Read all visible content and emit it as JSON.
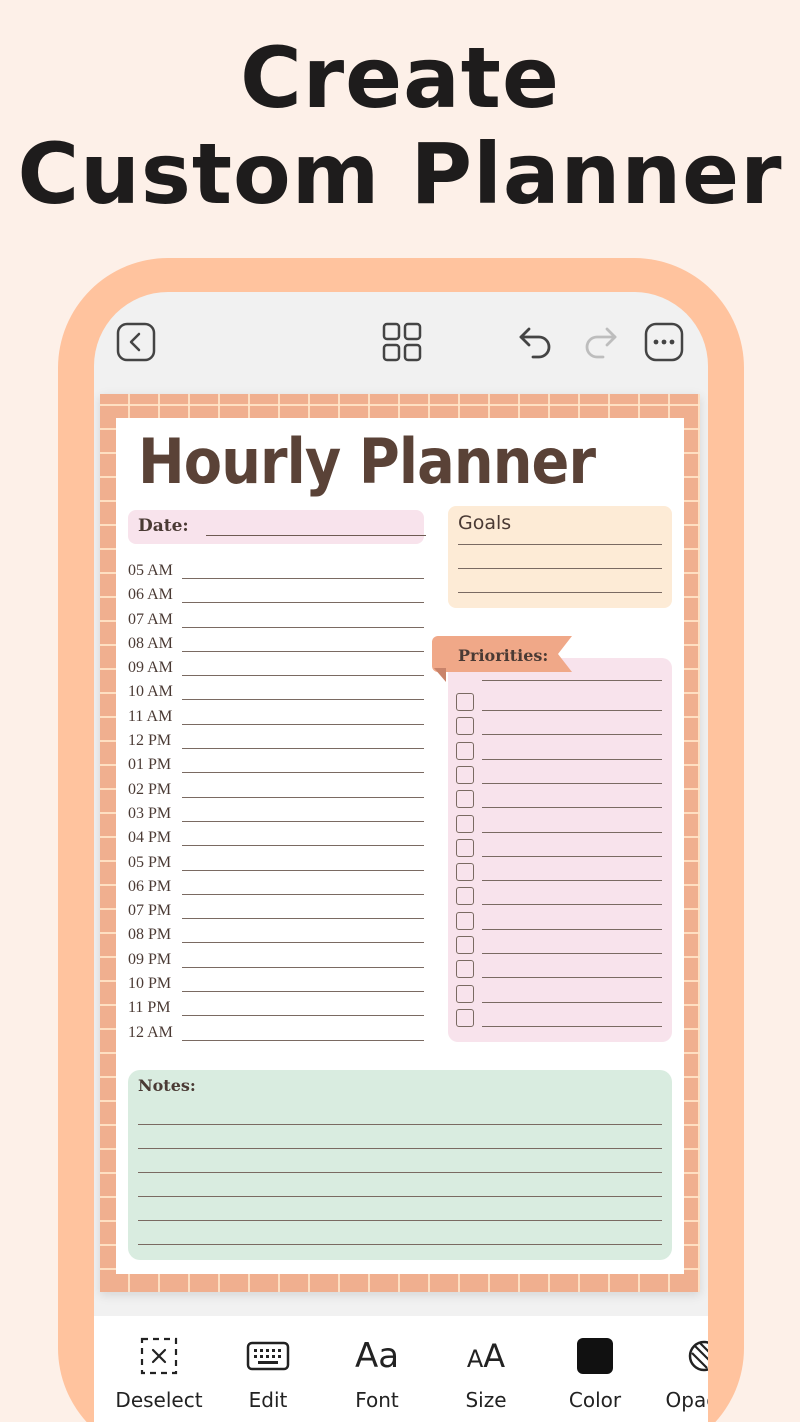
{
  "headline": {
    "line1": "Create",
    "line2": "Custom Planner"
  },
  "toolbar": {
    "back_icon": "back-chevron-icon",
    "grid_icon": "grid-icon",
    "undo_icon": "undo-icon",
    "redo_icon": "redo-icon",
    "more_icon": "more-icon"
  },
  "planner": {
    "title": "Hourly Planner",
    "date_label": "Date:",
    "hours": [
      "05 AM",
      "06 AM",
      "07 AM",
      "08 AM",
      "09 AM",
      "10 AM",
      "11 AM",
      "12 PM",
      "01 PM",
      "02 PM",
      "03 PM",
      "04 PM",
      "05 PM",
      "06 PM",
      "07 PM",
      "08 PM",
      "09 PM",
      "10 PM",
      "11 PM",
      "12 AM"
    ],
    "goals_label": "Goals",
    "priorities_label": "Priorities:",
    "notes_label": "Notes:"
  },
  "bottom_tools": [
    {
      "label": "Deselect",
      "icon": "deselect-icon"
    },
    {
      "label": "Edit",
      "icon": "keyboard-icon"
    },
    {
      "label": "Font",
      "icon": "font-icon",
      "glyph": "Aa"
    },
    {
      "label": "Size",
      "icon": "size-icon",
      "glyph": "AA"
    },
    {
      "label": "Color",
      "icon": "color-swatch-icon"
    },
    {
      "label": "Opacity",
      "icon": "opacity-icon"
    }
  ],
  "colors": {
    "background": "#fdf0e8",
    "phone_frame": "#ffc39e",
    "planner_border": "#f0af8f",
    "title_brown": "#5a4237",
    "date_pink": "#f8e3ec",
    "goals_peach": "#fdebd6",
    "notes_green": "#d9ece0",
    "color_swatch": "#111111"
  }
}
